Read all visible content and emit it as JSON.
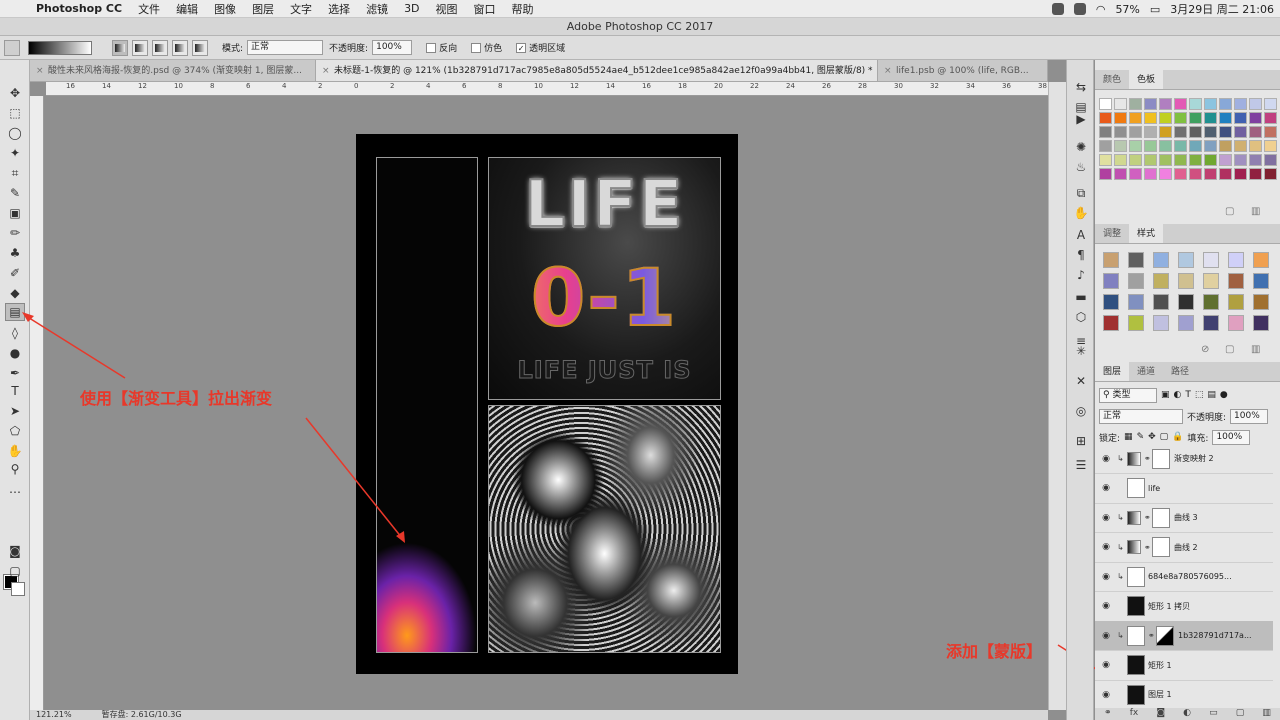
{
  "menubar": {
    "app": "Photoshop CC",
    "items": [
      "文件",
      "编辑",
      "图像",
      "图层",
      "文字",
      "选择",
      "滤镜",
      "3D",
      "视图",
      "窗口",
      "帮助"
    ],
    "battery": "57%",
    "clock": "3月29日 周二 21:06"
  },
  "window": {
    "title": "Adobe Photoshop CC 2017"
  },
  "options": {
    "mode_label": "模式:",
    "mode_value": "正常",
    "opacity_label": "不透明度:",
    "opacity_value": "100%",
    "reverse_label": "反向",
    "dither_label": "仿色",
    "transparency_label": "透明区域"
  },
  "tabs": [
    {
      "label": "酸性未来风格海报-恢复的.psd @ 374% (渐变映射 1, 图层蒙..."
    },
    {
      "label": "未标题-1-恢复的 @ 121% (1b328791d717ac7985e8a805d5524ae4_b512dee1ce985a842ae12f0a99a4bb41, 图层蒙版/8) *"
    },
    {
      "label": "life1.psb @ 100% (life, RGB..."
    }
  ],
  "ruler_ticks": [
    "16",
    "14",
    "12",
    "10",
    "8",
    "6",
    "4",
    "2",
    "0",
    "2",
    "4",
    "6",
    "8",
    "10",
    "12",
    "14",
    "16",
    "18",
    "20",
    "22",
    "24",
    "26",
    "28",
    "30",
    "32",
    "34",
    "36",
    "38"
  ],
  "poster": {
    "title": "LIFE",
    "number": "0-1",
    "tagline": "LIFE JUST IS"
  },
  "annotations": {
    "gradient_tool": "使用【渐变工具】拉出渐变",
    "add_mask": "添加【蒙版】"
  },
  "panels": {
    "swatches_tabs": [
      "颜色",
      "色板"
    ],
    "styles_tabs": [
      "调整",
      "样式"
    ],
    "layers_tabs": [
      "图层",
      "通道",
      "路径"
    ],
    "kind_filter": "类型",
    "blend_mode": "正常",
    "opacity_label": "不透明度:",
    "opacity_value": "100%",
    "lock_label": "锁定:",
    "fill_label": "填充:",
    "fill_value": "100%"
  },
  "swatch_colors": [
    "#ffffff",
    "#e6e6e6",
    "#9fb0a0",
    "#8c8cc4",
    "#b07fc0",
    "#e35ab5",
    "#a8d8d8",
    "#8cc4e0",
    "#88a8d8",
    "#a0b0e0",
    "#c0c8e8",
    "#d0d8f0",
    "#e85a1a",
    "#f07a10",
    "#f0a020",
    "#f0c020",
    "#c0d020",
    "#80c040",
    "#40a060",
    "#209090",
    "#2080c0",
    "#4060b0",
    "#8040a0",
    "#c04080",
    "#808080",
    "#909090",
    "#a0a0a0",
    "#b0b0b0",
    "#d0a020",
    "#707070",
    "#606060",
    "#506070",
    "#405080",
    "#7060a0",
    "#a06080",
    "#c07060",
    "#a0a0a0",
    "#b8c8b0",
    "#a8d0a8",
    "#98c898",
    "#88c0a0",
    "#78b8a8",
    "#70a8b8",
    "#80a0c0",
    "#c0a060",
    "#d0b070",
    "#e0c080",
    "#f0d090",
    "#e0e0a0",
    "#d0d890",
    "#c0d080",
    "#b0c870",
    "#a0c060",
    "#90b850",
    "#80b040",
    "#70a830",
    "#c0a0d0",
    "#a090c0",
    "#9080b0",
    "#8070a0",
    "#b040a0",
    "#c050b0",
    "#d060c0",
    "#e070d0",
    "#f080e0",
    "#e06090",
    "#d05080",
    "#c04070",
    "#b03060",
    "#a02050",
    "#902040",
    "#802030"
  ],
  "style_colors": [
    "#c8a070",
    "#606060",
    "#90b0e0",
    "#b0c8e0",
    "#e0e0f0",
    "#d0d0f8",
    "#f0a050",
    "#8080c0",
    "#a0a0a0",
    "#c0b060",
    "#d0c090",
    "#e0d0a0",
    "#a06040",
    "#4070b0",
    "#305080",
    "#8090c0",
    "#505050",
    "#303030",
    "#607030",
    "#b0a040",
    "#a07030",
    "#a03030",
    "#b0c040",
    "#c0c0e0",
    "#a0a0d0",
    "#404070",
    "#e0a0c0",
    "#403060"
  ],
  "layers": [
    {
      "name": "渐变映射 2",
      "type": "adj",
      "clip": true,
      "mask": true,
      "selected": false
    },
    {
      "name": "life",
      "type": "smart",
      "clip": false,
      "mask": false,
      "selected": false
    },
    {
      "name": "曲线 3",
      "type": "adj",
      "clip": true,
      "mask": true,
      "selected": false
    },
    {
      "name": "曲线 2",
      "type": "adj",
      "clip": true,
      "mask": true,
      "selected": false
    },
    {
      "name": "684e8a780576095...",
      "type": "smart",
      "clip": true,
      "mask": false,
      "selected": false
    },
    {
      "name": "矩形 1 拷贝",
      "type": "shape",
      "clip": false,
      "mask": false,
      "selected": false
    },
    {
      "name": "1b328791d717a...",
      "type": "smart",
      "clip": true,
      "mask": true,
      "selected": true
    },
    {
      "name": "矩形 1",
      "type": "shape",
      "clip": false,
      "mask": false,
      "selected": false
    },
    {
      "name": "图层 1",
      "type": "pixel",
      "clip": false,
      "mask": false,
      "selected": false
    }
  ],
  "status": {
    "zoom": "121.21%",
    "doc": "暂存盘: 2.61G/10.3G"
  }
}
